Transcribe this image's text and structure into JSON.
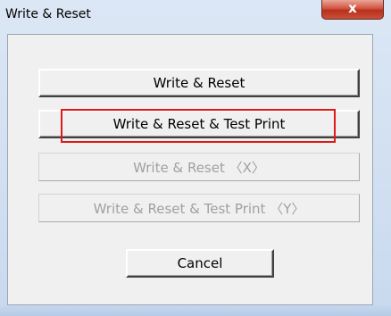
{
  "window": {
    "title": "Write & Reset",
    "close_glyph": "x"
  },
  "buttons": {
    "write_reset": "Write & Reset",
    "write_reset_test_print": "Write & Reset & Test Print",
    "write_reset_x": "Write & Reset  〈X〉",
    "write_reset_test_print_y": "Write & Reset & Test Print  〈Y〉",
    "cancel": "Cancel"
  },
  "annotation": {
    "highlight_color": "#e01818"
  }
}
